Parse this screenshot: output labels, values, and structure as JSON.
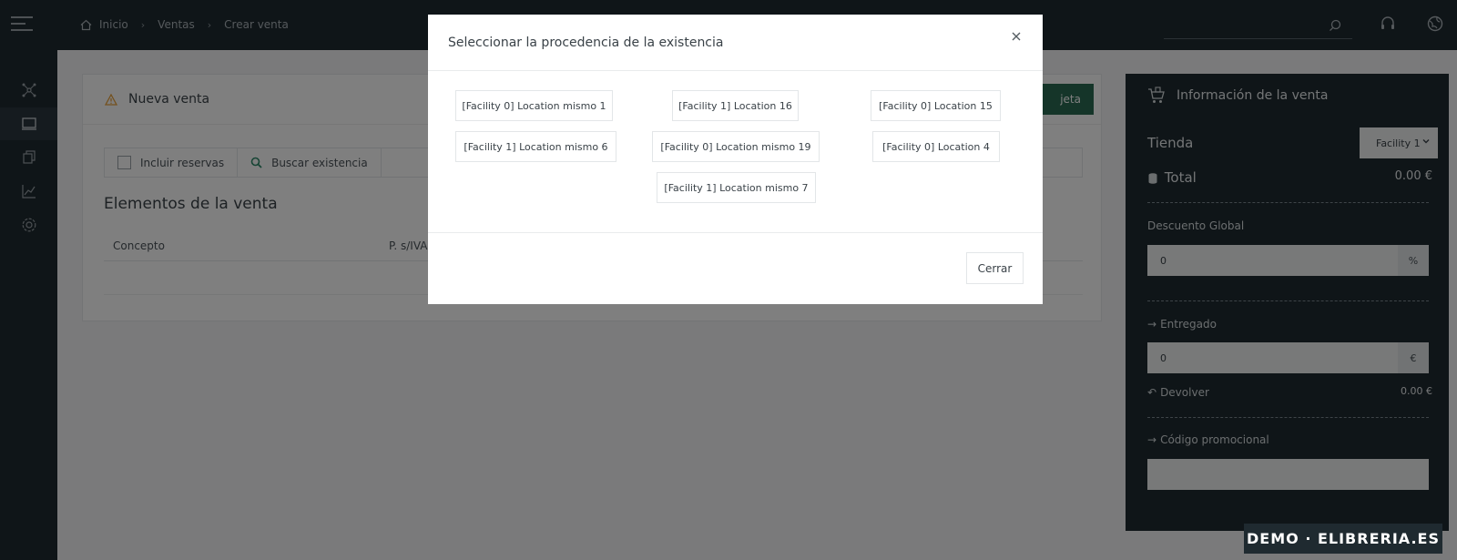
{
  "breadcrumb": {
    "home": "Inicio",
    "ventas": "Ventas",
    "current": "Crear venta"
  },
  "card": {
    "title": "Nueva venta",
    "green_button": "jeta",
    "include_reservations": "Incluir reservas",
    "search_stock": "Buscar existencia",
    "section_title": "Elementos de la venta",
    "columns": [
      "Concepto",
      "P. s/IVA"
    ]
  },
  "sale_info": {
    "title": "Información de la venta",
    "store_label": "Tienda",
    "store_value": "Facility 1",
    "total_label": "Total",
    "total_value": "0.00 €",
    "discount_label": "Descuento Global",
    "discount_value": "0",
    "discount_addon": "%",
    "delivered_label": "Entregado",
    "delivered_value": "0",
    "delivered_addon": "€",
    "return_label": "Devolver",
    "return_value": "0.00 €",
    "promo_label": "Código promocional"
  },
  "modal": {
    "title": "Seleccionar la procedencia de la existencia",
    "locations": [
      "[Facility 0] Location mismo 1",
      "[Facility 1] Location 16",
      "[Facility 0] Location 15",
      "[Facility 1] Location mismo 6",
      "[Facility 0] Location mismo 19",
      "[Facility 0] Location 4",
      "[Facility 1] Location mismo 7"
    ],
    "close_label": "Cerrar"
  },
  "watermark": "DEMO · ELIBRERIA.ES",
  "colors": {
    "dark": "#1f2a30",
    "accent_green": "#2a6b52",
    "warning": "#e8a13a",
    "search_green": "#2f8a6a"
  }
}
